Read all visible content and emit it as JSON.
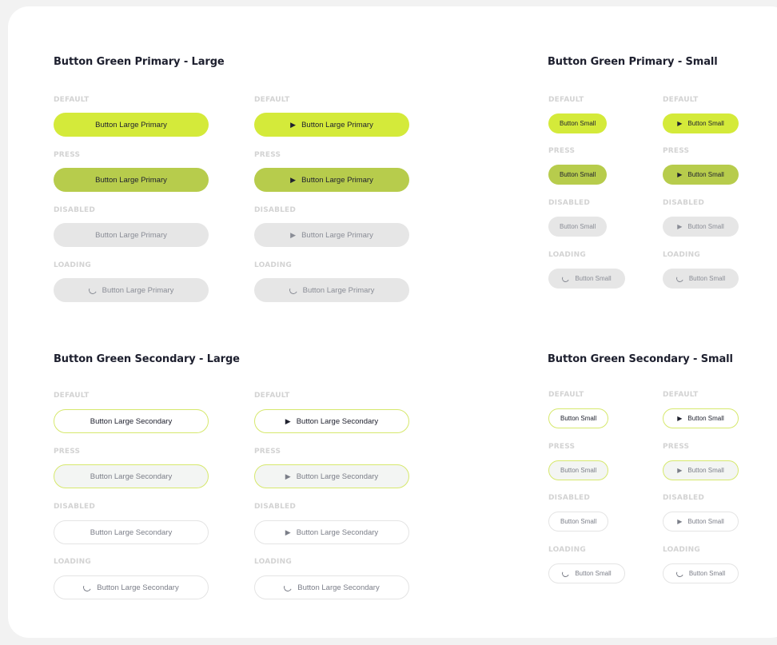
{
  "sections": {
    "primary_large": {
      "title": "Button Green Primary - Large",
      "labels": {
        "default": "DEFAULT",
        "press": "PRESS",
        "disabled": "DISABLED",
        "loading": "LOADING"
      },
      "button_label": "Button Large Primary"
    },
    "primary_small": {
      "title": "Button Green Primary - Small",
      "labels": {
        "default": "DEFAULT",
        "press": "PRESS",
        "disabled": "DISABLED",
        "loading": "LOADING"
      },
      "button_label": "Button Small"
    },
    "secondary_large": {
      "title": "Button Green Secondary - Large",
      "labels": {
        "default": "DEFAULT",
        "press": "PRESS",
        "disabled": "DISABLED",
        "loading": "LOADING"
      },
      "button_label": "Button Large Secondary"
    },
    "secondary_small": {
      "title": "Button Green Secondary - Small",
      "labels": {
        "default": "DEFAULT",
        "press": "PRESS",
        "disabled": "DISABLED",
        "loading": "LOADING"
      },
      "button_label": "Button Small"
    }
  },
  "icons": {
    "play": "play-icon",
    "loading": "loading-spinner-icon"
  },
  "colors": {
    "primary_default": "#d4ea3a",
    "primary_press": "#b7cc4c",
    "disabled": "#e6e6e6",
    "secondary_border": "#d6e86d",
    "title_text": "#1d1f2e",
    "state_label": "#d3d3d3"
  }
}
